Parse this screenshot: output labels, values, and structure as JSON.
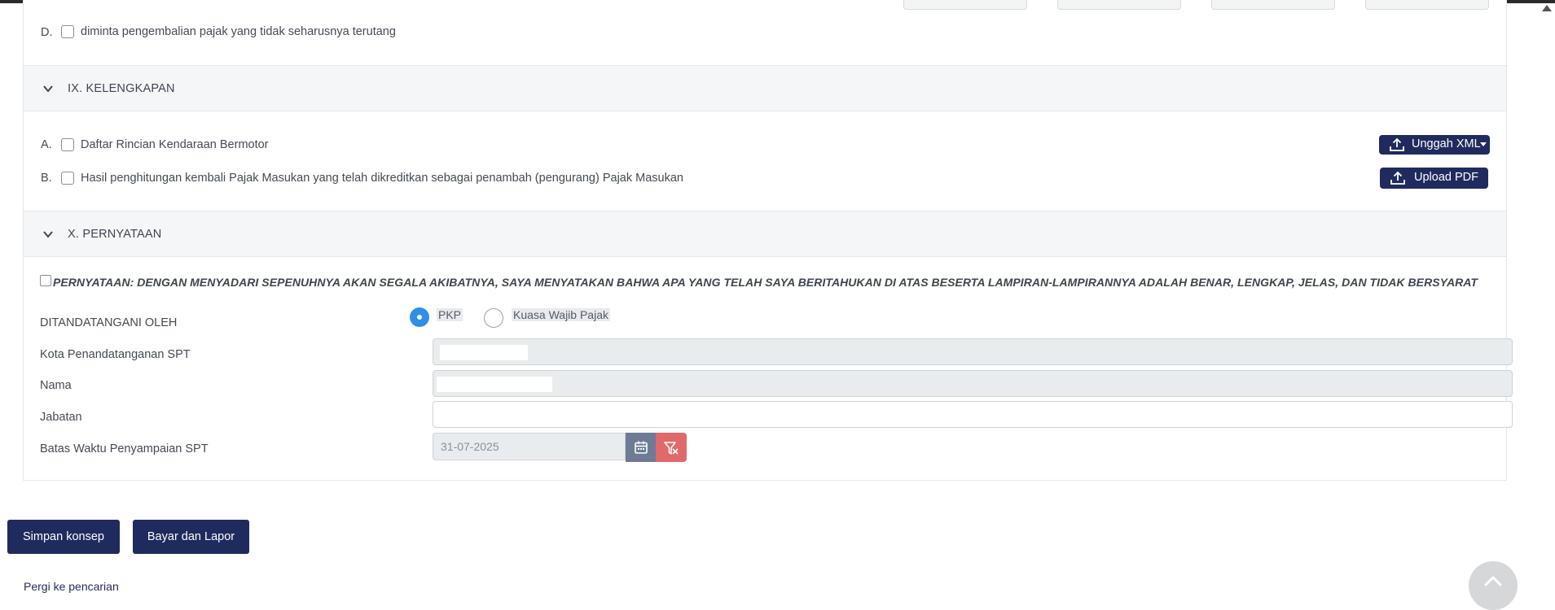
{
  "section_viii": {
    "item_d": {
      "letter": "D.",
      "label": "diminta pengembalian pajak yang tidak seharusnya terutang"
    }
  },
  "section_ix": {
    "title": "IX. KELENGKAPAN",
    "items": [
      {
        "letter": "A.",
        "label": "Daftar Rincian Kendaraan Bermotor",
        "button": "Unggah XML"
      },
      {
        "letter": "B.",
        "label": "Hasil penghitungan kembali Pajak Masukan yang telah dikreditkan sebagai penambah (pengurang) Pajak Masukan",
        "button": "Upload PDF"
      }
    ]
  },
  "section_x": {
    "title": "X. PERNYATAAN",
    "statement": "PERNYATAAN: DENGAN MENYADARI SEPENUHNYA AKAN SEGALA AKIBATNYA, SAYA MENYATAKAN BAHWA APA YANG TELAH SAYA BERITAHUKAN DI ATAS BESERTA LAMPIRAN-LAMPIRANNYA ADALAH BENAR, LENGKAP, JELAS, DAN TIDAK BERSYARAT",
    "signed_by_label": "DITANDATANGANI OLEH",
    "signed_by_options": [
      "PKP",
      "Kuasa Wajib Pajak"
    ],
    "signed_by_selected": "PKP",
    "city_label": "Kota Penandatanganan SPT",
    "city_value": "",
    "name_label": "Nama",
    "name_value": "",
    "position_label": "Jabatan",
    "position_value": "",
    "deadline_label": "Batas Waktu Penyampaian SPT",
    "deadline_value": "31-07-2025"
  },
  "footer": {
    "save_draft": "Simpan konsep",
    "pay_report": "Bayar dan Lapor",
    "goto_search": "Pergi ke pencarian"
  },
  "colors": {
    "primary": "#1f2b5e",
    "radio_selected": "#2f8fe8",
    "calendar_button": "#6e7b96",
    "clear_button": "#e06a6a"
  },
  "icons": [
    "chevron-down-icon",
    "upload-icon",
    "caret-down-icon",
    "calendar-icon",
    "filter-clear-icon",
    "chevron-up-icon"
  ]
}
